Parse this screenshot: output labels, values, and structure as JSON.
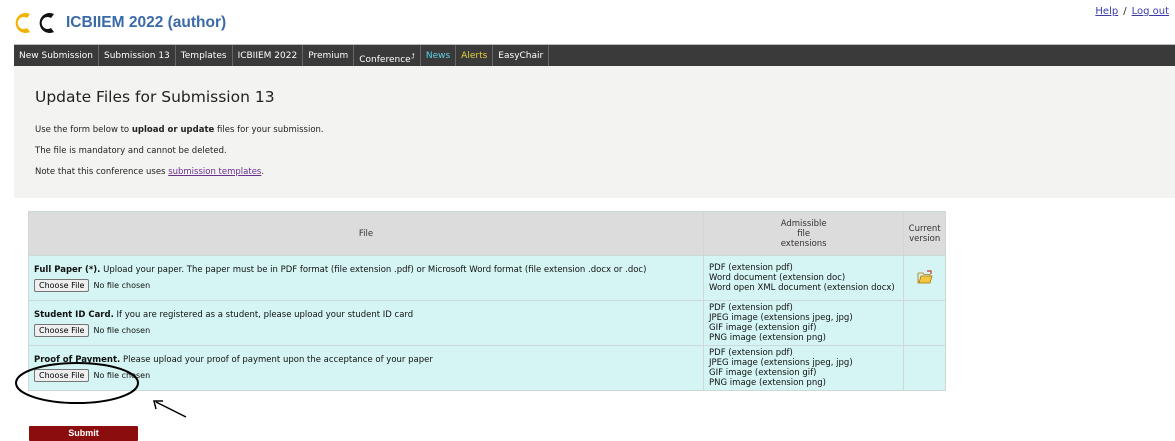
{
  "header": {
    "title": "ICBIIEM 2022 (author)",
    "links": {
      "help": "Help",
      "sep": "/",
      "logout": "Log out"
    },
    "logo": "easychair-logo"
  },
  "nav": [
    {
      "label": "New Submission"
    },
    {
      "label": "Submission 13"
    },
    {
      "label": "Templates"
    },
    {
      "label": "ICBIIEM 2022"
    },
    {
      "label": "Premium"
    },
    {
      "label": "Conference"
    },
    {
      "label": "News"
    },
    {
      "label": "Alerts"
    },
    {
      "label": "EasyChair"
    }
  ],
  "page": {
    "title": "Update Files for Submission 13",
    "line1_pre": "Use the form below to ",
    "line1_bold": "upload or update",
    "line1_post": " files for your submission.",
    "line2": "The file is mandatory and cannot be deleted.",
    "line3_pre": "Note that this conference uses ",
    "line3_link": "submission templates",
    "line3_post": "."
  },
  "table": {
    "headers": {
      "file": "File",
      "ext_1": "Admissible",
      "ext_2": "file",
      "ext_3": "extensions",
      "cur_1": "Current",
      "cur_2": "version"
    },
    "choose_label": "Choose File",
    "no_file": "No file chosen",
    "rows": [
      {
        "title": "Full Paper (*).",
        "desc": " Upload your paper. The paper must be in PDF format (file extension .pdf) or Microsoft Word format (file extension .docx or .doc)",
        "exts": [
          "PDF (extension pdf)",
          "Word document (extension doc)",
          "Word open XML document (extension docx)"
        ],
        "has_current": true
      },
      {
        "title": "Student ID Card.",
        "desc": " If you are registered as a student, please upload your student ID card",
        "exts": [
          "PDF (extension pdf)",
          "JPEG image (extensions jpeg, jpg)",
          "GIF image (extension gif)",
          "PNG image (extension png)"
        ],
        "has_current": false
      },
      {
        "title": "Proof of Payment.",
        "desc": " Please upload your proof of payment upon the acceptance of your paper",
        "exts": [
          "PDF (extension pdf)",
          "JPEG image (extensions jpeg, jpg)",
          "GIF image (extension gif)",
          "PNG image (extension png)"
        ],
        "has_current": false
      }
    ]
  },
  "submit_label": "Submit",
  "colors": {
    "navbar": "#3a3a3a",
    "news": "#5cd3e8",
    "alerts": "#e8d23c",
    "row_bg": "#d4f5f3",
    "submit": "#8b0d0d",
    "title_blue": "#3a6aa8"
  }
}
